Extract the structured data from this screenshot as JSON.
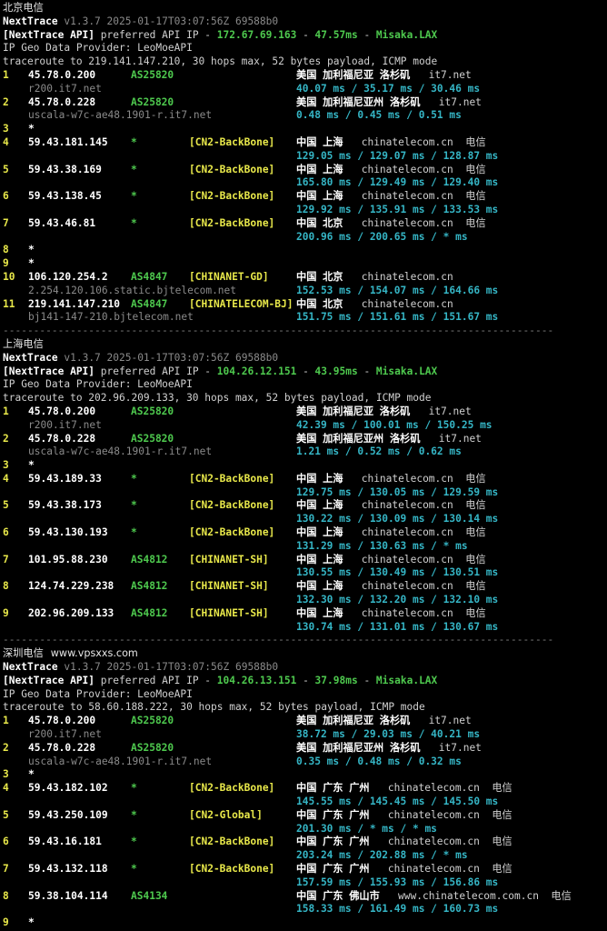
{
  "sections": [
    {
      "title": "北京电信",
      "subtitle": "",
      "app": "NextTrace",
      "version": "v1.3.7 2025-01-17T03:07:56Z 69588b0",
      "api_prefix": "[NextTrace API]",
      "api_mid": " preferred API IP - ",
      "api_ip": "172.67.69.163",
      "api_ms": "47.57ms",
      "api_node": "Misaka.LAX",
      "geo_provider": "IP Geo Data Provider: LeoMoeAPI",
      "traceroute": "traceroute to 219.141.147.210, 30 hops max, 52 bytes payload, ICMP mode",
      "hops": [
        {
          "n": "1",
          "ip": "45.78.0.200",
          "asn": "AS25820",
          "tag": "",
          "geo": "美国 加利福尼亚 洛杉矶",
          "domain": "it7.net",
          "carrier": "",
          "host": "r200.it7.net",
          "rtt": "40.07 ms / 35.17 ms / 30.46 ms"
        },
        {
          "n": "2",
          "ip": "45.78.0.228",
          "asn": "AS25820",
          "tag": "",
          "geo": "美国 加利福尼亚州 洛杉矶",
          "domain": "it7.net",
          "carrier": "",
          "host": "uscala-w7c-ae48.1901-r.it7.net",
          "rtt": "0.48 ms / 0.45 ms / 0.51 ms"
        },
        {
          "n": "3",
          "ip": "*",
          "asn": "",
          "tag": "",
          "geo": "",
          "domain": "",
          "carrier": "",
          "host": "",
          "rtt": ""
        },
        {
          "n": "4",
          "ip": "59.43.181.145",
          "asn": "*",
          "tag": "[CN2-BackBone]",
          "geo": "中国 上海",
          "domain": "chinatelecom.cn",
          "carrier": "电信",
          "host": "",
          "rtt": "129.05 ms / 129.07 ms / 128.87 ms"
        },
        {
          "n": "5",
          "ip": "59.43.38.169",
          "asn": "*",
          "tag": "[CN2-BackBone]",
          "geo": "中国 上海",
          "domain": "chinatelecom.cn",
          "carrier": "电信",
          "host": "",
          "rtt": "165.80 ms / 129.49 ms / 129.40 ms"
        },
        {
          "n": "6",
          "ip": "59.43.138.45",
          "asn": "*",
          "tag": "[CN2-BackBone]",
          "geo": "中国 上海",
          "domain": "chinatelecom.cn",
          "carrier": "电信",
          "host": "",
          "rtt": "129.92 ms / 135.91 ms / 133.53 ms"
        },
        {
          "n": "7",
          "ip": "59.43.46.81",
          "asn": "*",
          "tag": "[CN2-BackBone]",
          "geo": "中国 北京",
          "domain": "chinatelecom.cn",
          "carrier": "电信",
          "host": "",
          "rtt": "200.96 ms / 200.65 ms / * ms"
        },
        {
          "n": "8",
          "ip": "*",
          "asn": "",
          "tag": "",
          "geo": "",
          "domain": "",
          "carrier": "",
          "host": "",
          "rtt": ""
        },
        {
          "n": "9",
          "ip": "*",
          "asn": "",
          "tag": "",
          "geo": "",
          "domain": "",
          "carrier": "",
          "host": "",
          "rtt": ""
        },
        {
          "n": "10",
          "ip": "106.120.254.2",
          "asn": "AS4847",
          "tag": "[CHINANET-GD]",
          "geo": "中国 北京",
          "domain": "chinatelecom.cn",
          "carrier": "",
          "host": "2.254.120.106.static.bjtelecom.net",
          "rtt": "152.53 ms / 154.07 ms / 164.66 ms"
        },
        {
          "n": "11",
          "ip": "219.141.147.210",
          "asn": "AS4847",
          "tag": "[CHINATELECOM-BJ]",
          "geo": "中国 北京",
          "domain": "chinatelecom.cn",
          "carrier": "",
          "host": "bj141-147-210.bjtelecom.net",
          "rtt": "151.75 ms / 151.61 ms / 151.67 ms"
        }
      ]
    },
    {
      "title": "上海电信",
      "subtitle": "",
      "app": "NextTrace",
      "version": "v1.3.7 2025-01-17T03:07:56Z 69588b0",
      "api_prefix": "[NextTrace API]",
      "api_mid": " preferred API IP - ",
      "api_ip": "104.26.12.151",
      "api_ms": "43.95ms",
      "api_node": "Misaka.LAX",
      "geo_provider": "IP Geo Data Provider: LeoMoeAPI",
      "traceroute": "traceroute to 202.96.209.133, 30 hops max, 52 bytes payload, ICMP mode",
      "hops": [
        {
          "n": "1",
          "ip": "45.78.0.200",
          "asn": "AS25820",
          "tag": "",
          "geo": "美国 加利福尼亚 洛杉矶",
          "domain": "it7.net",
          "carrier": "",
          "host": "r200.it7.net",
          "rtt": "42.39 ms / 100.01 ms / 150.25 ms"
        },
        {
          "n": "2",
          "ip": "45.78.0.228",
          "asn": "AS25820",
          "tag": "",
          "geo": "美国 加利福尼亚州 洛杉矶",
          "domain": "it7.net",
          "carrier": "",
          "host": "uscala-w7c-ae48.1901-r.it7.net",
          "rtt": "1.21 ms / 0.52 ms / 0.62 ms"
        },
        {
          "n": "3",
          "ip": "*",
          "asn": "",
          "tag": "",
          "geo": "",
          "domain": "",
          "carrier": "",
          "host": "",
          "rtt": ""
        },
        {
          "n": "4",
          "ip": "59.43.189.33",
          "asn": "*",
          "tag": "[CN2-BackBone]",
          "geo": "中国 上海",
          "domain": "chinatelecom.cn",
          "carrier": "电信",
          "host": "",
          "rtt": "129.75 ms / 130.05 ms / 129.59 ms"
        },
        {
          "n": "5",
          "ip": "59.43.38.173",
          "asn": "*",
          "tag": "[CN2-BackBone]",
          "geo": "中国 上海",
          "domain": "chinatelecom.cn",
          "carrier": "电信",
          "host": "",
          "rtt": "130.22 ms / 130.09 ms / 130.14 ms"
        },
        {
          "n": "6",
          "ip": "59.43.130.193",
          "asn": "*",
          "tag": "[CN2-BackBone]",
          "geo": "中国 上海",
          "domain": "chinatelecom.cn",
          "carrier": "电信",
          "host": "",
          "rtt": "131.29 ms / 130.63 ms / * ms"
        },
        {
          "n": "7",
          "ip": "101.95.88.230",
          "asn": "AS4812",
          "tag": "[CHINANET-SH]",
          "geo": "中国 上海",
          "domain": "chinatelecom.cn",
          "carrier": "电信",
          "host": "",
          "rtt": "130.55 ms / 130.49 ms / 130.51 ms"
        },
        {
          "n": "8",
          "ip": "124.74.229.238",
          "asn": "AS4812",
          "tag": "[CHINANET-SH]",
          "geo": "中国 上海",
          "domain": "chinatelecom.cn",
          "carrier": "电信",
          "host": "",
          "rtt": "132.30 ms / 132.20 ms / 132.10 ms"
        },
        {
          "n": "9",
          "ip": "202.96.209.133",
          "asn": "AS4812",
          "tag": "[CHINANET-SH]",
          "geo": "中国 上海",
          "domain": "chinatelecom.cn",
          "carrier": "电信",
          "host": "",
          "rtt": "130.74 ms / 131.01 ms / 130.67 ms"
        }
      ]
    },
    {
      "title": "深圳电信",
      "subtitle": "www.vpsxxs.com",
      "app": "NextTrace",
      "version": "v1.3.7 2025-01-17T03:07:56Z 69588b0",
      "api_prefix": "[NextTrace API]",
      "api_mid": " preferred API IP - ",
      "api_ip": "104.26.13.151",
      "api_ms": "37.98ms",
      "api_node": "Misaka.LAX",
      "geo_provider": "IP Geo Data Provider: LeoMoeAPI",
      "traceroute": "traceroute to 58.60.188.222, 30 hops max, 52 bytes payload, ICMP mode",
      "hops": [
        {
          "n": "1",
          "ip": "45.78.0.200",
          "asn": "AS25820",
          "tag": "",
          "geo": "美国 加利福尼亚 洛杉矶",
          "domain": "it7.net",
          "carrier": "",
          "host": "r200.it7.net",
          "rtt": "38.72 ms / 29.03 ms / 40.21 ms"
        },
        {
          "n": "2",
          "ip": "45.78.0.228",
          "asn": "AS25820",
          "tag": "",
          "geo": "美国 加利福尼亚州 洛杉矶",
          "domain": "it7.net",
          "carrier": "",
          "host": "uscala-w7c-ae48.1901-r.it7.net",
          "rtt": "0.35 ms / 0.48 ms / 0.32 ms"
        },
        {
          "n": "3",
          "ip": "*",
          "asn": "",
          "tag": "",
          "geo": "",
          "domain": "",
          "carrier": "",
          "host": "",
          "rtt": ""
        },
        {
          "n": "4",
          "ip": "59.43.182.102",
          "asn": "*",
          "tag": "[CN2-BackBone]",
          "geo": "中国 广东 广州",
          "domain": "chinatelecom.cn",
          "carrier": "电信",
          "host": "",
          "rtt": "145.55 ms / 145.45 ms / 145.50 ms"
        },
        {
          "n": "5",
          "ip": "59.43.250.109",
          "asn": "*",
          "tag": "[CN2-Global]",
          "geo": "中国 广东 广州",
          "domain": "chinatelecom.cn",
          "carrier": "电信",
          "host": "",
          "rtt": "201.30 ms / * ms / * ms"
        },
        {
          "n": "6",
          "ip": "59.43.16.181",
          "asn": "*",
          "tag": "[CN2-BackBone]",
          "geo": "中国 广东 广州",
          "domain": "chinatelecom.cn",
          "carrier": "电信",
          "host": "",
          "rtt": "203.24 ms / 202.88 ms / * ms"
        },
        {
          "n": "7",
          "ip": "59.43.132.118",
          "asn": "*",
          "tag": "[CN2-BackBone]",
          "geo": "中国 广东 广州",
          "domain": "chinatelecom.cn",
          "carrier": "电信",
          "host": "",
          "rtt": "157.59 ms / 155.93 ms / 156.86 ms"
        },
        {
          "n": "8",
          "ip": "59.38.104.114",
          "asn": "AS4134",
          "tag": "",
          "geo": "中国 广东 佛山市",
          "domain": "www.chinatelecom.com.cn",
          "carrier": "电信",
          "host": "",
          "rtt": "158.33 ms / 161.49 ms / 160.73 ms"
        },
        {
          "n": "9",
          "ip": "*",
          "asn": "",
          "tag": "",
          "geo": "",
          "domain": "",
          "carrier": "",
          "host": "",
          "rtt": ""
        }
      ]
    }
  ],
  "separator": "------------------------------------------------------------------------------------------",
  "colors": {
    "background": "#000000",
    "hop_number": "#e8e84a",
    "asn": "#4ec94e",
    "tag": "#e8e84a",
    "rtt": "#35b5c5",
    "hostname": "#8a8a8a",
    "api_ip": "#4ec94e"
  }
}
